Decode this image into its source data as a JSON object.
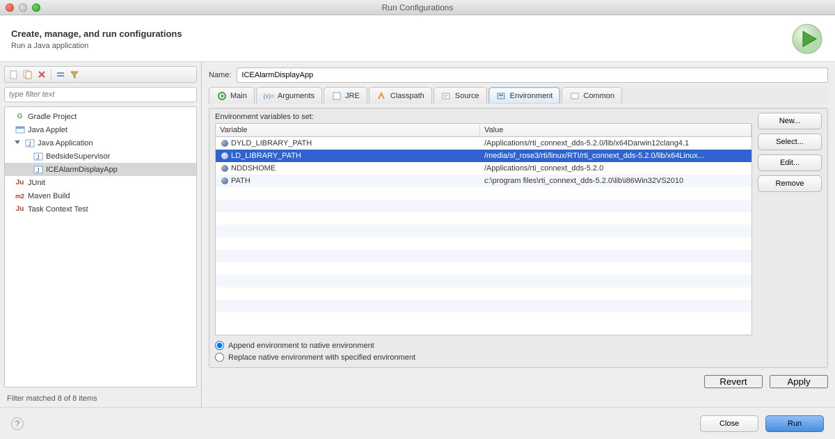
{
  "window": {
    "title": "Run Configurations"
  },
  "header": {
    "title": "Create, manage, and run configurations",
    "subtitle": "Run a Java application"
  },
  "left": {
    "filter_placeholder": "type filter text",
    "tree": {
      "gradle": "Gradle Project",
      "applet": "Java Applet",
      "javaapp": "Java Application",
      "bedside": "BedsideSupervisor",
      "icealarm": "ICEAlarmDisplayApp",
      "junit": "JUnit",
      "maven": "Maven Build",
      "taskctx": "Task Context Test"
    },
    "status": "Filter matched 8 of 8 items"
  },
  "right": {
    "name_label": "Name:",
    "name_value": "ICEAlarmDisplayApp",
    "tabs": {
      "main": "Main",
      "arguments": "Arguments",
      "jre": "JRE",
      "classpath": "Classpath",
      "source": "Source",
      "environment": "Environment",
      "common": "Common"
    },
    "env": {
      "section_label": "Environment variables to set:",
      "col_variable": "Variable",
      "col_value": "Value",
      "rows": [
        {
          "name": "DYLD_LIBRARY_PATH",
          "value": "/Applications/rti_connext_dds-5.2.0/lib/x64Darwin12clang4.1"
        },
        {
          "name": "LD_LIBRARY_PATH",
          "value": "/media/sf_rose3/rti/linux/RTI/rti_connext_dds-5.2.0/lib/x64Linux..."
        },
        {
          "name": "NDDSHOME",
          "value": "/Applications/rti_connext_dds-5.2.0"
        },
        {
          "name": "PATH",
          "value": "c:\\program files\\rti_connext_dds-5.2.0\\lib\\i86Win32VS2010"
        }
      ],
      "radio_append": "Append environment to native environment",
      "radio_replace": "Replace native environment with specified environment"
    },
    "buttons": {
      "new": "New...",
      "select": "Select...",
      "edit": "Edit...",
      "remove": "Remove",
      "revert": "Revert",
      "apply": "Apply"
    }
  },
  "footer": {
    "close": "Close",
    "run": "Run"
  }
}
